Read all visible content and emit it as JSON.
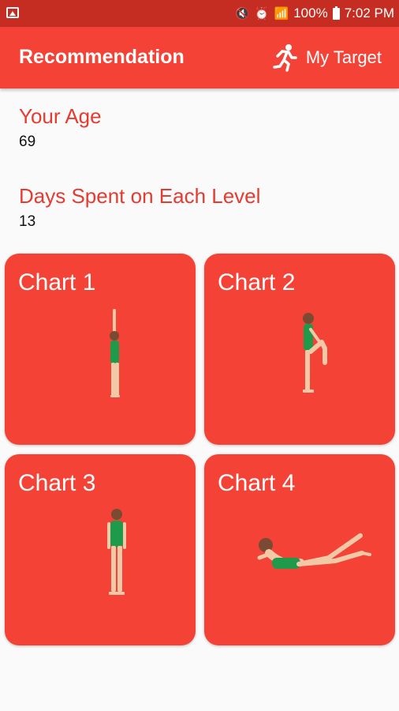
{
  "status_bar": {
    "battery": "100%",
    "time": "7:02 PM",
    "icons": [
      "image-icon",
      "mute-icon",
      "alarm-icon",
      "wifi-icon",
      "signal-icon",
      "battery-icon"
    ]
  },
  "app_bar": {
    "title": "Recommendation",
    "action_label": "My Target",
    "action_icon": "running-icon",
    "color": "#f44336"
  },
  "fields": [
    {
      "label": "Your Age",
      "value": "69"
    },
    {
      "label": "Days Spent on Each Level",
      "value": "13"
    }
  ],
  "charts": [
    {
      "title": "Chart 1",
      "figure": "arms-up-stretch-figure"
    },
    {
      "title": "Chart 2",
      "figure": "knee-raise-figure"
    },
    {
      "title": "Chart 3",
      "figure": "standing-figure"
    },
    {
      "title": "Chart 4",
      "figure": "prone-leg-lift-figure"
    }
  ]
}
